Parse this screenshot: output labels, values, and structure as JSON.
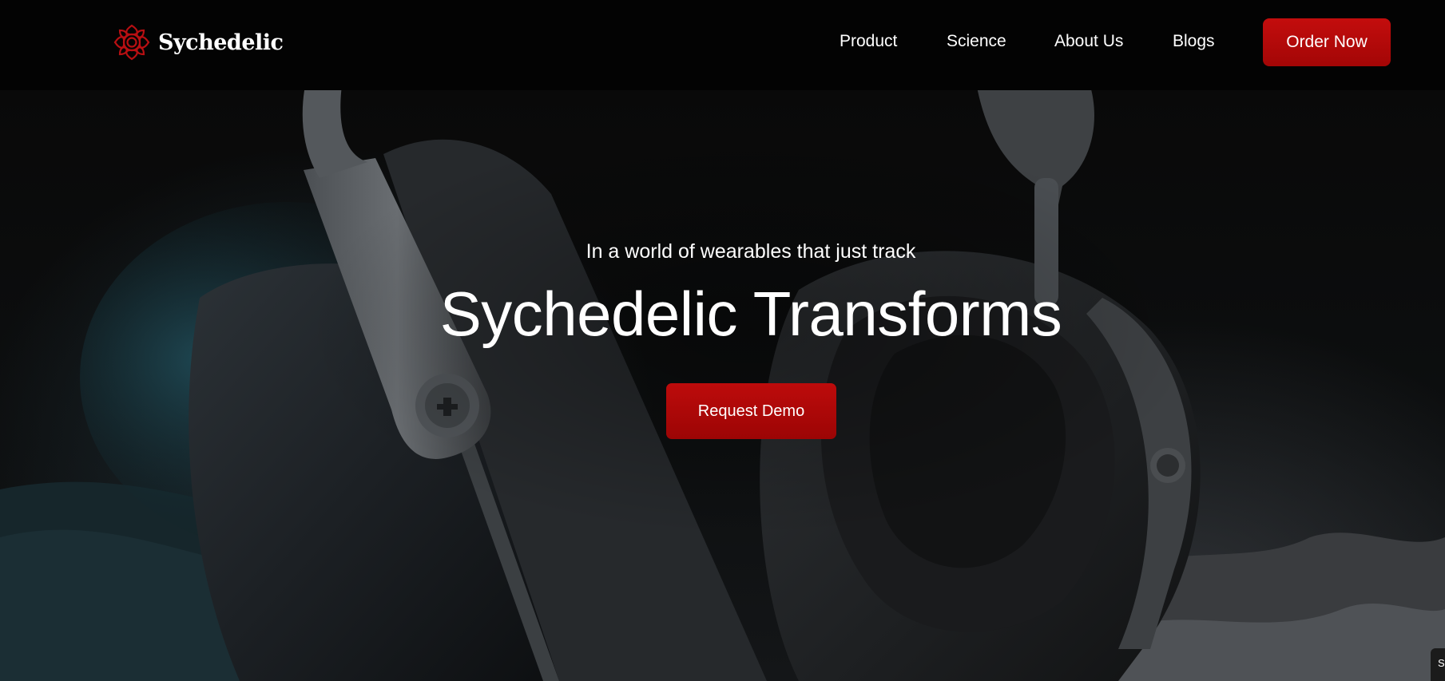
{
  "brand": {
    "name": "Sychedelic",
    "logo_icon": "rose-mandala-icon",
    "accent_color": "#b50808"
  },
  "nav": {
    "items": [
      {
        "label": "Product"
      },
      {
        "label": "Science"
      },
      {
        "label": "About Us"
      },
      {
        "label": "Blogs"
      }
    ],
    "cta_label": "Order Now"
  },
  "hero": {
    "tagline": "In a world of wearables that just track",
    "title": "Sychedelic Transforms",
    "cta_label": "Request Demo",
    "background_image": "headphones-photo"
  },
  "corner_tab": {
    "label": "S"
  }
}
